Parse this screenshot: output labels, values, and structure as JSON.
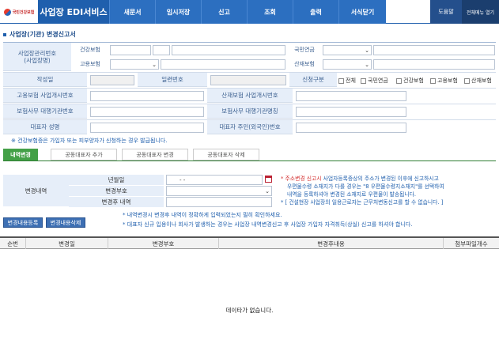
{
  "header": {
    "logo_text": "국민건강보험",
    "app_name": "사업장 EDI서비스",
    "menu": [
      "새문서",
      "임시저장",
      "신고",
      "조회",
      "출력",
      "서식닫기"
    ],
    "help": "도움말",
    "all_menu": "전체메뉴 열기"
  },
  "page": {
    "title": "사업장(기관) 변경신고서"
  },
  "form": {
    "biz_no_label": "사업장관리번호\n(사업장명)",
    "health_ins": "건강보험",
    "employ_ins": "고용보험",
    "national_pension": "국민연금",
    "industrial_ins": "산재보험",
    "date_label": "작성일",
    "serial_label": "일련번호",
    "report_type_label": "신청구분",
    "report_types": [
      "전체",
      "국민연금",
      "건강보험",
      "고용보험",
      "산재보험"
    ],
    "employ_biz_no": "고용보험 사업개시번호",
    "ind_biz_no": "산재보험 사업개시번호",
    "agency_no": "보험사무 대행기관번호",
    "agency_name": "보험사무 대행기관명칭",
    "rep_name": "대표자 성명",
    "rep_id": "대표자 주민(외국인)번호"
  },
  "note_health": "※ 건강보험증은 가입자 또는 피부양자가 신청하는 경우 발급됩니다.",
  "tabs": [
    "내역변경",
    "공동대표자 추가",
    "공동대표자 변경",
    "공동대표자 삭제"
  ],
  "change": {
    "section_label": "변경내역",
    "date_label": "년월일",
    "date_value": "-  -",
    "code_label": "변경부호",
    "after_label": "변경후 내역",
    "info_line1_red": "* 주소변경 신고시",
    "info_line1": " 사업자등록증상의 주소가 변경된 이후에 신고하시고",
    "info_line2": "우편물수령 소재지가 다를 경우는 \"8 우편물수령지소재지\"를 선택하여",
    "info_line3": "내역을 등록하셔야 변경된 소재지로 우편물이 발송됩니다.",
    "info_line4": "* [ 건설현장 사업장의 일용근로자는 근무처변동신고를 할 수 없습니다. ]",
    "btn_register": "변경내용등록",
    "btn_delete": "변경내용삭제",
    "note_a": "* 내역변경시 변경후 내역이 정확하게 입력되었는지 필히 확인하세요.",
    "note_b": "* 대표자 신규 입용이나 회사가 발생하는 경우는 사업장 내역변경신고 후 사업장 가입자 자격취득(상실) 신고를 하셔야 합니다."
  },
  "grid": {
    "columns": [
      "순번",
      "변경일",
      "변경부호",
      "변경후내용",
      "첨부파일개수"
    ],
    "empty": "데이타가 없습니다."
  }
}
